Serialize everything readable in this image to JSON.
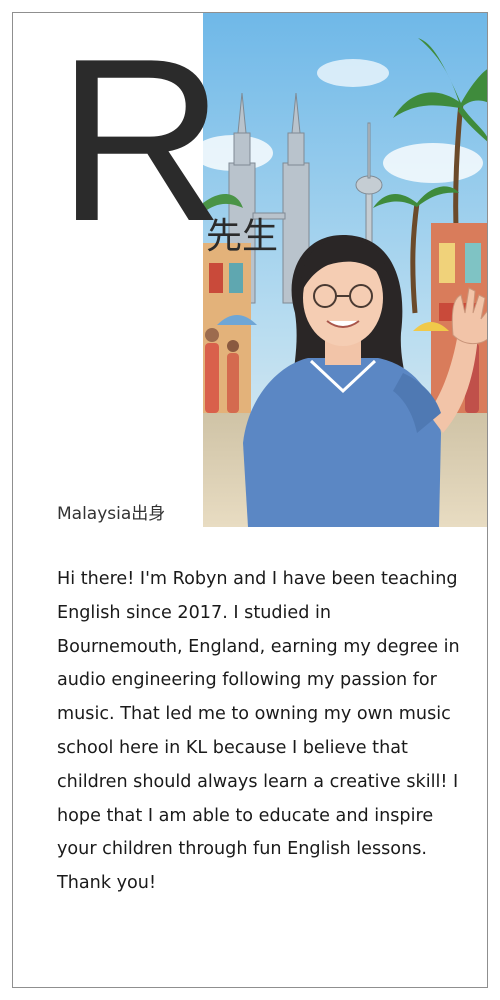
{
  "profile": {
    "initial": "R",
    "honorific": "先生",
    "origin": "Malaysia出身",
    "bio": "Hi there! I'm Robyn and I have been teaching English since 2017. I studied in Bournemouth, England, earning my degree in audio engineering following my passion for music. That led me to owning my own music school here in KL because I believe that children should always learn a creative skill! I hope that I am able to educate and inspire your children through fun English lessons. Thank you!"
  },
  "colors": {
    "sky": "#8cc8ea",
    "shirt": "#5b87c4",
    "hair": "#2a2626",
    "text": "#2b2b2b"
  },
  "icons": {
    "portrait": "illustrated-teacher-waving-in-kuala-lumpur-street"
  }
}
